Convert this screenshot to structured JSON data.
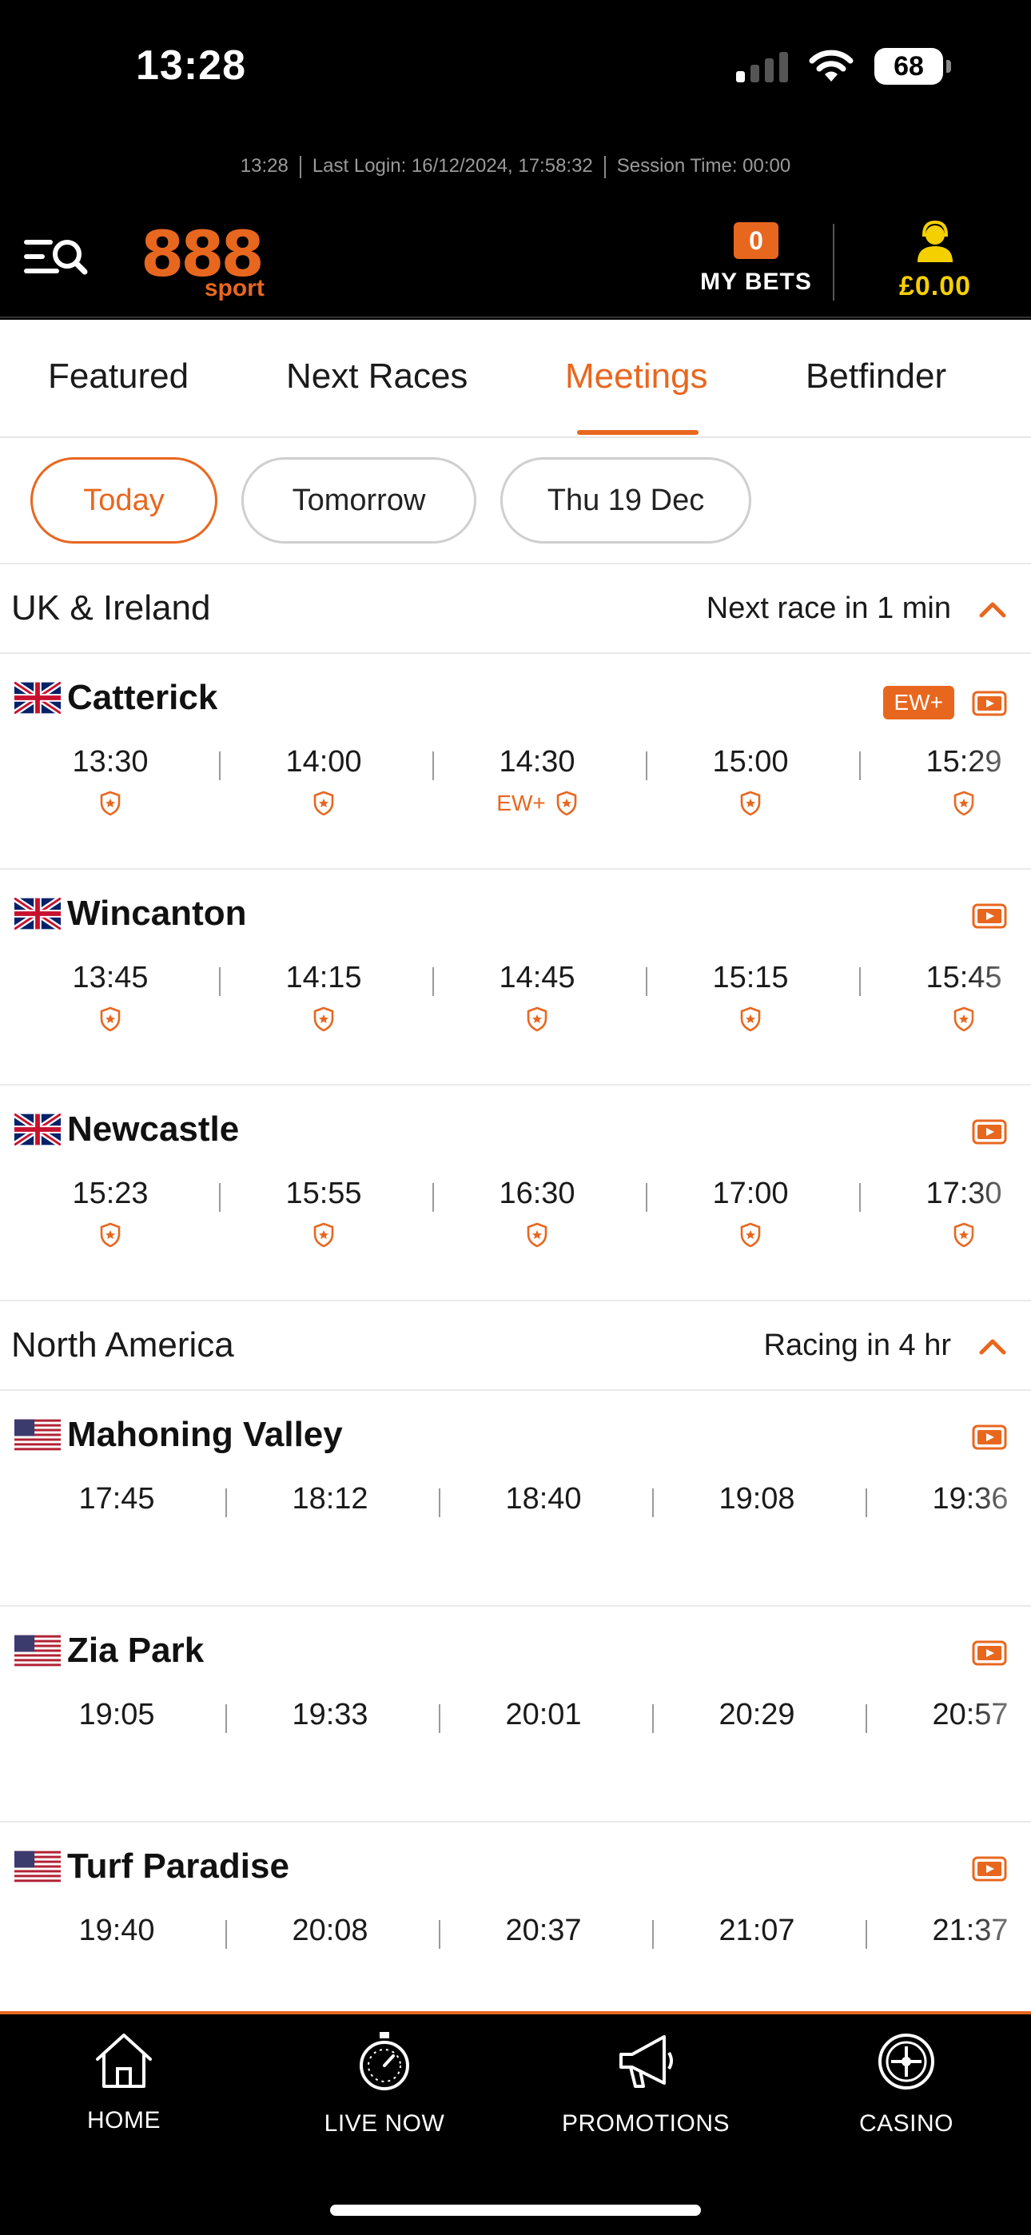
{
  "status_bar": {
    "time": "13:28",
    "battery": "68"
  },
  "session": {
    "time": "13:28",
    "last_login": "Last Login: 16/12/2024, 17:58:32",
    "session_time": "Session Time: 00:00"
  },
  "header": {
    "logo_main": "888",
    "logo_sub": "sport",
    "my_bets_count": "0",
    "my_bets_label": "MY BETS",
    "balance": "£0.00"
  },
  "tabs": [
    "Featured",
    "Next Races",
    "Meetings",
    "Betfinder"
  ],
  "active_tab": "Meetings",
  "day_filters": [
    "Today",
    "Tomorrow",
    "Thu 19 Dec"
  ],
  "active_day": "Today",
  "regions": [
    {
      "name": "UK & Ireland",
      "next": "Next race in 1 min",
      "meetings": [
        {
          "name": "Catterick",
          "flag": "uk",
          "badge": "EW+",
          "races": [
            {
              "time": "13:30",
              "ew": ""
            },
            {
              "time": "14:00",
              "ew": ""
            },
            {
              "time": "14:30",
              "ew": "EW+"
            },
            {
              "time": "15:00",
              "ew": ""
            },
            {
              "time": "15:29",
              "ew": ""
            }
          ]
        },
        {
          "name": "Wincanton",
          "flag": "uk",
          "badge": "",
          "races": [
            {
              "time": "13:45",
              "ew": ""
            },
            {
              "time": "14:15",
              "ew": ""
            },
            {
              "time": "14:45",
              "ew": ""
            },
            {
              "time": "15:15",
              "ew": ""
            },
            {
              "time": "15:45",
              "ew": ""
            }
          ]
        },
        {
          "name": "Newcastle",
          "flag": "uk",
          "badge": "",
          "races": [
            {
              "time": "15:23",
              "ew": ""
            },
            {
              "time": "15:55",
              "ew": ""
            },
            {
              "time": "16:30",
              "ew": ""
            },
            {
              "time": "17:00",
              "ew": ""
            },
            {
              "time": "17:30",
              "ew": ""
            }
          ]
        }
      ]
    },
    {
      "name": "North America",
      "next": "Racing in 4 hr",
      "meetings": [
        {
          "name": "Mahoning Valley",
          "flag": "us",
          "badge": "",
          "races": [
            {
              "time": "17:45"
            },
            {
              "time": "18:12"
            },
            {
              "time": "18:40"
            },
            {
              "time": "19:08"
            },
            {
              "time": "19:36"
            }
          ]
        },
        {
          "name": "Zia Park",
          "flag": "us",
          "badge": "",
          "races": [
            {
              "time": "19:05"
            },
            {
              "time": "19:33"
            },
            {
              "time": "20:01"
            },
            {
              "time": "20:29"
            },
            {
              "time": "20:57"
            }
          ]
        },
        {
          "name": "Turf Paradise",
          "flag": "us",
          "badge": "",
          "races": [
            {
              "time": "19:40"
            },
            {
              "time": "20:08"
            },
            {
              "time": "20:37"
            },
            {
              "time": "21:07"
            },
            {
              "time": "21:37"
            }
          ]
        }
      ]
    }
  ],
  "bottom_nav": [
    "HOME",
    "LIVE NOW",
    "PROMOTIONS",
    "CASINO"
  ],
  "colors": {
    "accent": "#e8671f",
    "balance": "#f5d000"
  }
}
